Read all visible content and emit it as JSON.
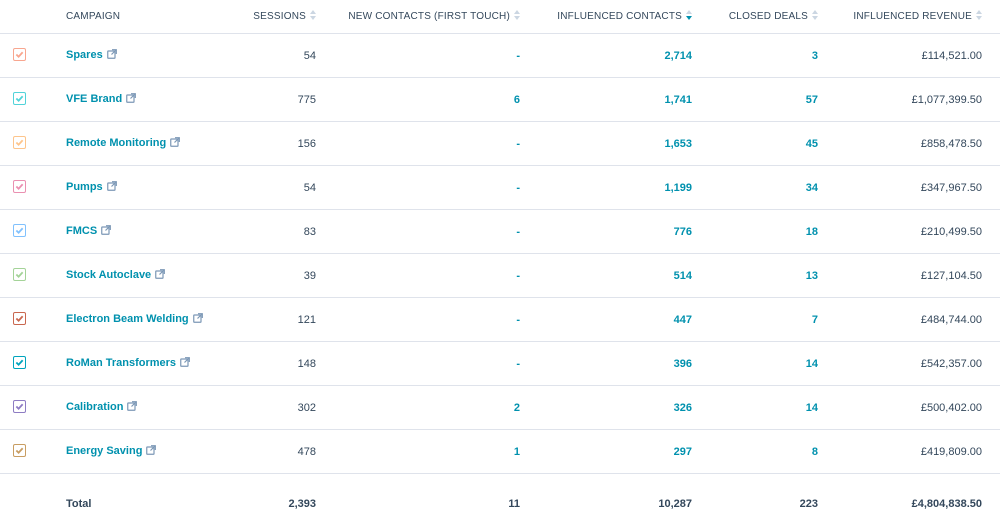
{
  "columns": [
    {
      "label": "CAMPAIGN",
      "sortable": false
    },
    {
      "label": "SESSIONS",
      "sortable": true,
      "sorted": false
    },
    {
      "label": "NEW CONTACTS (FIRST TOUCH)",
      "sortable": true,
      "sorted": false
    },
    {
      "label": "INFLUENCED CONTACTS",
      "sortable": true,
      "sorted": "desc"
    },
    {
      "label": "CLOSED DEALS",
      "sortable": true,
      "sorted": false
    },
    {
      "label": "INFLUENCED REVENUE",
      "sortable": true,
      "sorted": false
    }
  ],
  "rows": [
    {
      "name": "Spares",
      "color": "#f8a68f",
      "sessions": "54",
      "new_contacts": "-",
      "influenced_contacts": "2,714",
      "closed_deals": "3",
      "revenue": "£114,521.00"
    },
    {
      "name": "VFE Brand",
      "color": "#51d3d9",
      "sessions": "775",
      "new_contacts": "6",
      "influenced_contacts": "1,741",
      "closed_deals": "57",
      "revenue": "£1,077,399.50"
    },
    {
      "name": "Remote Monitoring",
      "color": "#fdc58c",
      "sessions": "156",
      "new_contacts": "-",
      "influenced_contacts": "1,653",
      "closed_deals": "45",
      "revenue": "£858,478.50"
    },
    {
      "name": "Pumps",
      "color": "#ea90b1",
      "sessions": "54",
      "new_contacts": "-",
      "influenced_contacts": "1,199",
      "closed_deals": "34",
      "revenue": "£347,967.50"
    },
    {
      "name": "FMCS",
      "color": "#81c1fd",
      "sessions": "83",
      "new_contacts": "-",
      "influenced_contacts": "776",
      "closed_deals": "18",
      "revenue": "£210,499.50"
    },
    {
      "name": "Stock Autoclave",
      "color": "#a4d398",
      "sessions": "39",
      "new_contacts": "-",
      "influenced_contacts": "514",
      "closed_deals": "13",
      "revenue": "£127,104.50"
    },
    {
      "name": "Electron Beam Welding",
      "color": "#c9674f",
      "sessions": "121",
      "new_contacts": "-",
      "influenced_contacts": "447",
      "closed_deals": "7",
      "revenue": "£484,744.00"
    },
    {
      "name": "RoMan Transformers",
      "color": "#00a4bd",
      "sessions": "148",
      "new_contacts": "-",
      "influenced_contacts": "396",
      "closed_deals": "14",
      "revenue": "£542,357.00"
    },
    {
      "name": "Calibration",
      "color": "#8e7cc3",
      "sessions": "302",
      "new_contacts": "2",
      "influenced_contacts": "326",
      "closed_deals": "14",
      "revenue": "£500,402.00"
    },
    {
      "name": "Energy Saving",
      "color": "#c89d62",
      "sessions": "478",
      "new_contacts": "1",
      "influenced_contacts": "297",
      "closed_deals": "8",
      "revenue": "£419,809.00"
    }
  ],
  "total": {
    "label": "Total",
    "sessions": "2,393",
    "new_contacts": "11",
    "influenced_contacts": "10,287",
    "closed_deals": "223",
    "revenue": "£4,804,838.50"
  }
}
